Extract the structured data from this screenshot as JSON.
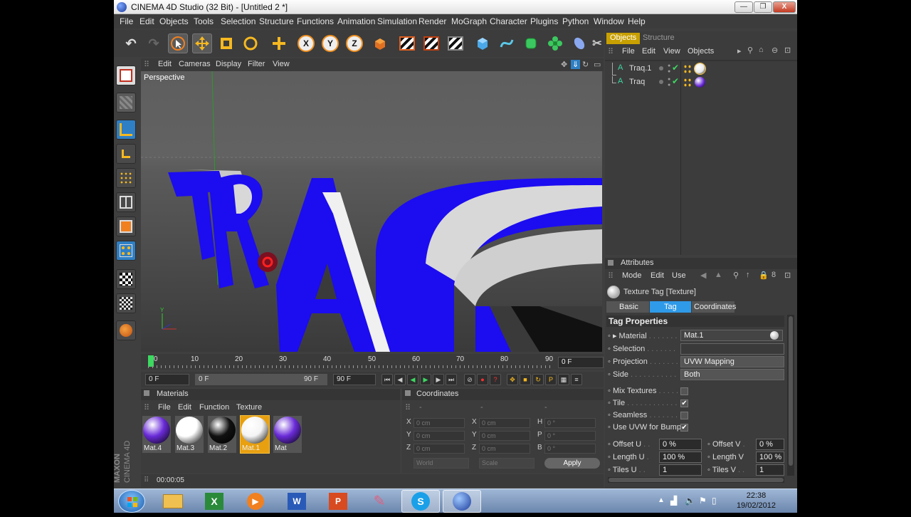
{
  "window": {
    "title": "CINEMA 4D Studio (32 Bit) - [Untitled 2 *]",
    "min": "—",
    "max": "❐",
    "close": "X"
  },
  "menubar": [
    "File",
    "Edit",
    "Objects",
    "Tools",
    "Selection",
    "Structure",
    "Functions",
    "Animation",
    "Simulation",
    "Render",
    "MoGraph",
    "Character",
    "Plugins",
    "Python",
    "Window",
    "Help"
  ],
  "toolbar": {
    "axis_x": "X",
    "axis_y": "Y",
    "axis_z": "Z"
  },
  "viewport": {
    "menu": [
      "Edit",
      "Cameras",
      "Display",
      "Filter",
      "View"
    ],
    "label": "Perspective",
    "text3d": "TRAQ"
  },
  "timeline": {
    "ticks": [
      "0",
      "10",
      "20",
      "30",
      "40",
      "50",
      "60",
      "70",
      "80",
      "90"
    ],
    "current_frame": "0 F"
  },
  "playbar": {
    "start": "0 F",
    "range_start": "0 F",
    "range_end": "90 F",
    "end": "90 F"
  },
  "materials": {
    "title": "Materials",
    "menu": [
      "File",
      "Edit",
      "Function",
      "Texture"
    ],
    "items": [
      {
        "name": "Mat.4",
        "color": "#6a2bd8"
      },
      {
        "name": "Mat.3",
        "color": "#ffffff"
      },
      {
        "name": "Mat.2",
        "color": "#111111"
      },
      {
        "name": "Mat.1",
        "color": "#f4f4f4",
        "selected": true
      },
      {
        "name": "Mat",
        "color": "#6a2bd8"
      }
    ]
  },
  "coordinates": {
    "title": "Coordinates",
    "header": [
      "-",
      "-",
      "-"
    ],
    "rows": [
      {
        "a": "X",
        "av": "0 cm",
        "b": "X",
        "bv": "0 cm",
        "c": "H",
        "cv": "0 °"
      },
      {
        "a": "Y",
        "av": "0 cm",
        "b": "Y",
        "bv": "0 cm",
        "c": "P",
        "cv": "0 °"
      },
      {
        "a": "Z",
        "av": "0 cm",
        "b": "Z",
        "bv": "0 cm",
        "c": "B",
        "cv": "0 °"
      }
    ],
    "world": "World",
    "scale": "Scale",
    "apply": "Apply"
  },
  "status": {
    "time": "00:00:05"
  },
  "objects_panel": {
    "tabs": [
      "Objects",
      "Structure"
    ],
    "menu": [
      "File",
      "Edit",
      "View",
      "Objects"
    ],
    "items": [
      {
        "name": "Traq.1",
        "tag_color": "#e8e8e8"
      },
      {
        "name": "Traq",
        "tag_color": "#6a2bd8"
      }
    ]
  },
  "attributes": {
    "title": "Attributes",
    "menu": [
      "Mode",
      "Edit",
      "User"
    ],
    "object": "Texture Tag [Texture]",
    "tabs": [
      "Basic",
      "Tag",
      "Coordinates"
    ],
    "section": "Tag Properties",
    "material_label": "Material",
    "material_value": "Mat.1",
    "selection_label": "Selection",
    "projection_label": "Projection",
    "projection_value": "UVW Mapping",
    "side_label": "Side",
    "side_value": "Both",
    "mix_label": "Mix Textures",
    "tile_label": "Tile",
    "tile_check": "✔",
    "seamless_label": "Seamless",
    "uvw_label": "Use UVW for Bump",
    "uvw_check": "✔",
    "offset_u_label": "Offset U",
    "offset_u": "0 %",
    "offset_v_label": "Offset V",
    "offset_v": "0 %",
    "length_u_label": "Length U",
    "length_u": "100 %",
    "length_v_label": "Length V",
    "length_v": "100 %",
    "tiles_u_label": "Tiles U",
    "tiles_u": "1",
    "tiles_v_label": "Tiles V",
    "tiles_v": "1"
  },
  "maxon": {
    "brand": "MAXON",
    "product": "CINEMA 4D"
  },
  "taskbar": {
    "time": "22:38",
    "date": "19/02/2012"
  }
}
